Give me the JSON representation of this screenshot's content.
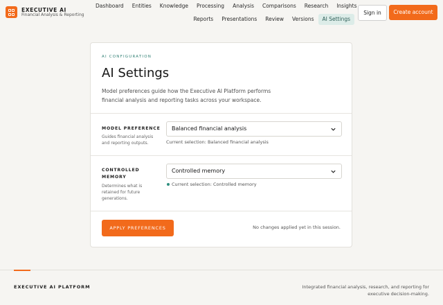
{
  "brand": {
    "title": "EXECUTIVE AI",
    "subtitle": "Financial Analysis & Reporting"
  },
  "nav": {
    "primary": [
      "Dashboard",
      "Entities",
      "Knowledge",
      "Processing",
      "Analysis",
      "Comparisons",
      "Research",
      "Insights"
    ],
    "secondary": [
      "Reports",
      "Presentations",
      "Review",
      "Versions",
      "AI Settings"
    ],
    "active": "AI Settings"
  },
  "auth": {
    "signin": "Sign in",
    "create": "Create account"
  },
  "card": {
    "eyebrow": "AI CONFIGURATION",
    "title": "AI Settings",
    "description": "Model preferences guide how the Executive AI Platform performs financial analysis and reporting tasks across your workspace.",
    "model": {
      "label": "MODEL PREFERENCE",
      "help": "Guides financial analysis and reporting outputs.",
      "value": "Balanced financial analysis",
      "current": "Current selection: Balanced financial analysis"
    },
    "memory": {
      "label": "CONTROLLED MEMORY",
      "help": "Determines what is retained for future generations.",
      "value": "Controlled memory",
      "current": "Current selection: Controlled memory"
    },
    "apply": "APPLY PREFERENCES",
    "status": "No changes applied yet in this session."
  },
  "footer": {
    "brand": "EXECUTIVE AI PLATFORM",
    "tagline": "Integrated financial analysis, research, and reporting for executive decision-making."
  },
  "colors": {
    "accent": "#f26a1b",
    "teal": "#2f7f73",
    "active_tab_bg": "#dcece8"
  }
}
